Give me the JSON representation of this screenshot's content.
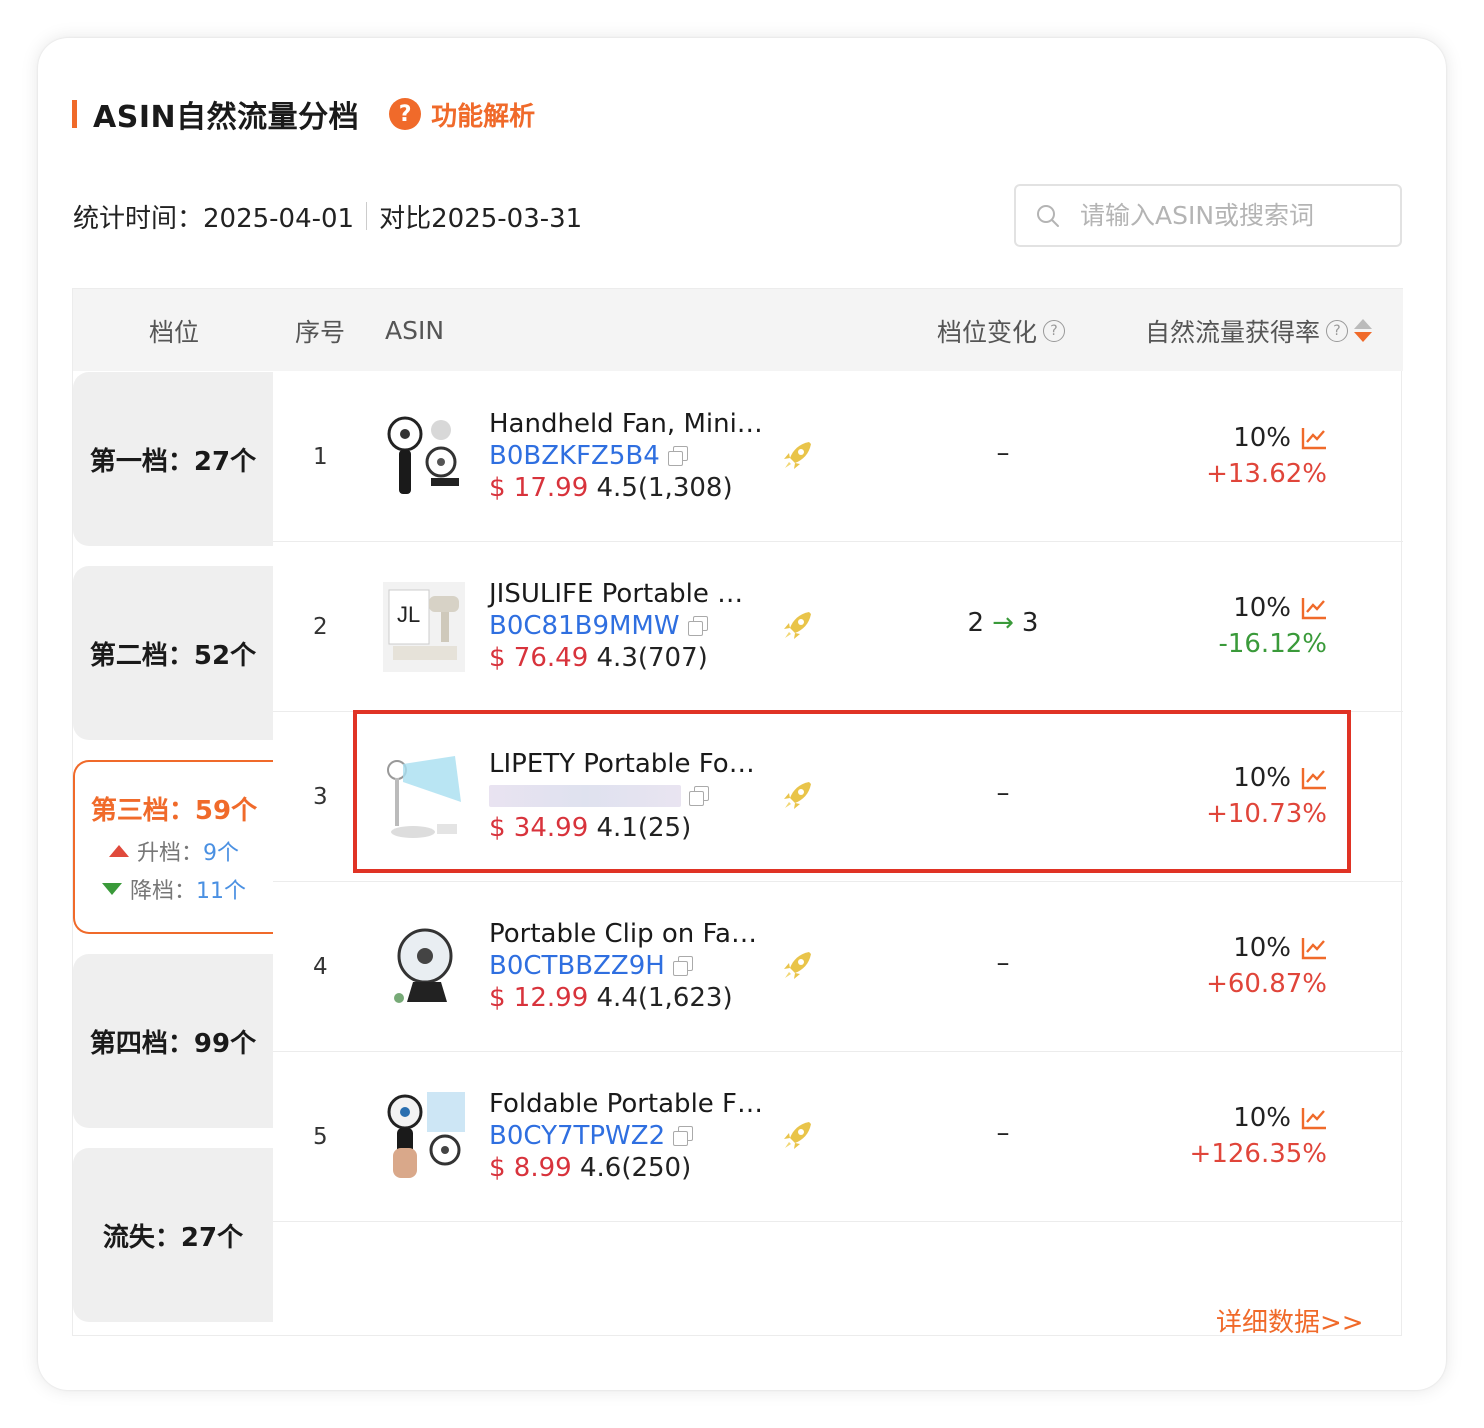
{
  "header": {
    "title": "ASIN自然流量分档",
    "help_label": "功能解析"
  },
  "stats": {
    "label": "统计时间：2025-04-01",
    "compare": "对比2025-03-31"
  },
  "search": {
    "placeholder": "请输入ASIN或搜索词",
    "value": ""
  },
  "columns": {
    "tier": "档位",
    "seq": "序号",
    "asin": "ASIN",
    "change": "档位变化",
    "rate": "自然流量获得率"
  },
  "tiers": [
    {
      "label": "第一档：27个"
    },
    {
      "label": "第二档：52个"
    },
    {
      "label": "第三档：59个",
      "up_label": "升档：",
      "up_count": "9个",
      "down_label": "降档：",
      "down_count": "11个"
    },
    {
      "label": "第四档：99个"
    },
    {
      "label": "流失：27个"
    }
  ],
  "rows": [
    {
      "seq": "1",
      "title": "Handheld Fan, Mini…",
      "asin": "B0BZKFZ5B4",
      "price": "$ 17.99",
      "rating": "4.5(1,308)",
      "change": "–",
      "rate": "10%",
      "rate_change": "+13.62%"
    },
    {
      "seq": "2",
      "title": "JISULIFE Portable …",
      "asin": "B0C81B9MMW",
      "price": "$ 76.49",
      "rating": "4.3(707)",
      "change_from": "2",
      "change_arrow": "→",
      "change_to": "3",
      "rate": "10%",
      "rate_change": "-16.12%"
    },
    {
      "seq": "3",
      "title": "LIPETY Portable Fo…",
      "asin": "",
      "price": "$ 34.99",
      "rating": "4.1(25)",
      "change": "–",
      "rate": "10%",
      "rate_change": "+10.73%"
    },
    {
      "seq": "4",
      "title": "Portable Clip on Fa…",
      "asin": "B0CTBBZZ9H",
      "price": "$ 12.99",
      "rating": "4.4(1,623)",
      "change": "–",
      "rate": "10%",
      "rate_change": "+60.87%"
    },
    {
      "seq": "5",
      "title": "Foldable Portable F…",
      "asin": "B0CY7TPWZ2",
      "price": "$ 8.99",
      "rating": "4.6(250)",
      "change": "–",
      "rate": "10%",
      "rate_change": "+126.35%"
    }
  ],
  "footer": {
    "detail_link": "详细数据>>"
  },
  "colors": {
    "accent": "#f06a2a",
    "link_blue": "#2f6fe0",
    "price_red": "#d8333c",
    "up_red": "#e0453a",
    "down_green": "#3a9a3a",
    "highlight_red": "#e03325"
  }
}
